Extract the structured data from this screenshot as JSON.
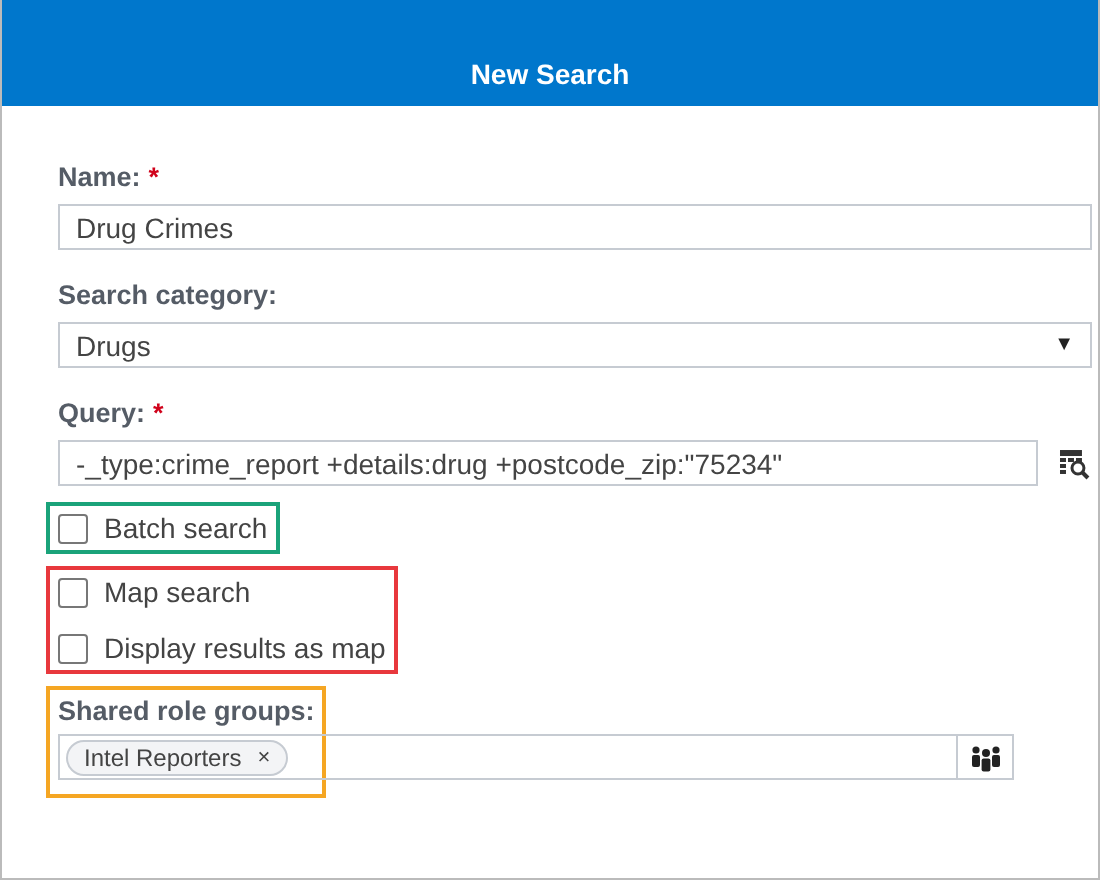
{
  "dialog": {
    "title": "New Search"
  },
  "name_field": {
    "label": "Name:",
    "required_mark": "*",
    "value": "Drug Crimes"
  },
  "category_field": {
    "label": "Search category:",
    "value": "Drugs",
    "dropdown_arrow": "▼"
  },
  "query_field": {
    "label": "Query:",
    "required_mark": "*",
    "value": "-_type:crime_report +details:drug +postcode_zip:\"75234\""
  },
  "option_groups": [
    {
      "color": "#1aa37a",
      "options": [
        {
          "label": "Batch search",
          "checked": false
        }
      ]
    },
    {
      "color": "#e8383d",
      "options": [
        {
          "label": "Map search",
          "checked": false
        },
        {
          "label": "Display results as map",
          "checked": false
        }
      ]
    }
  ],
  "shared_roles": {
    "color": "#f5a623",
    "label": "Shared role groups:",
    "tags": [
      {
        "label": "Intel Reporters",
        "remove": "×"
      }
    ]
  }
}
